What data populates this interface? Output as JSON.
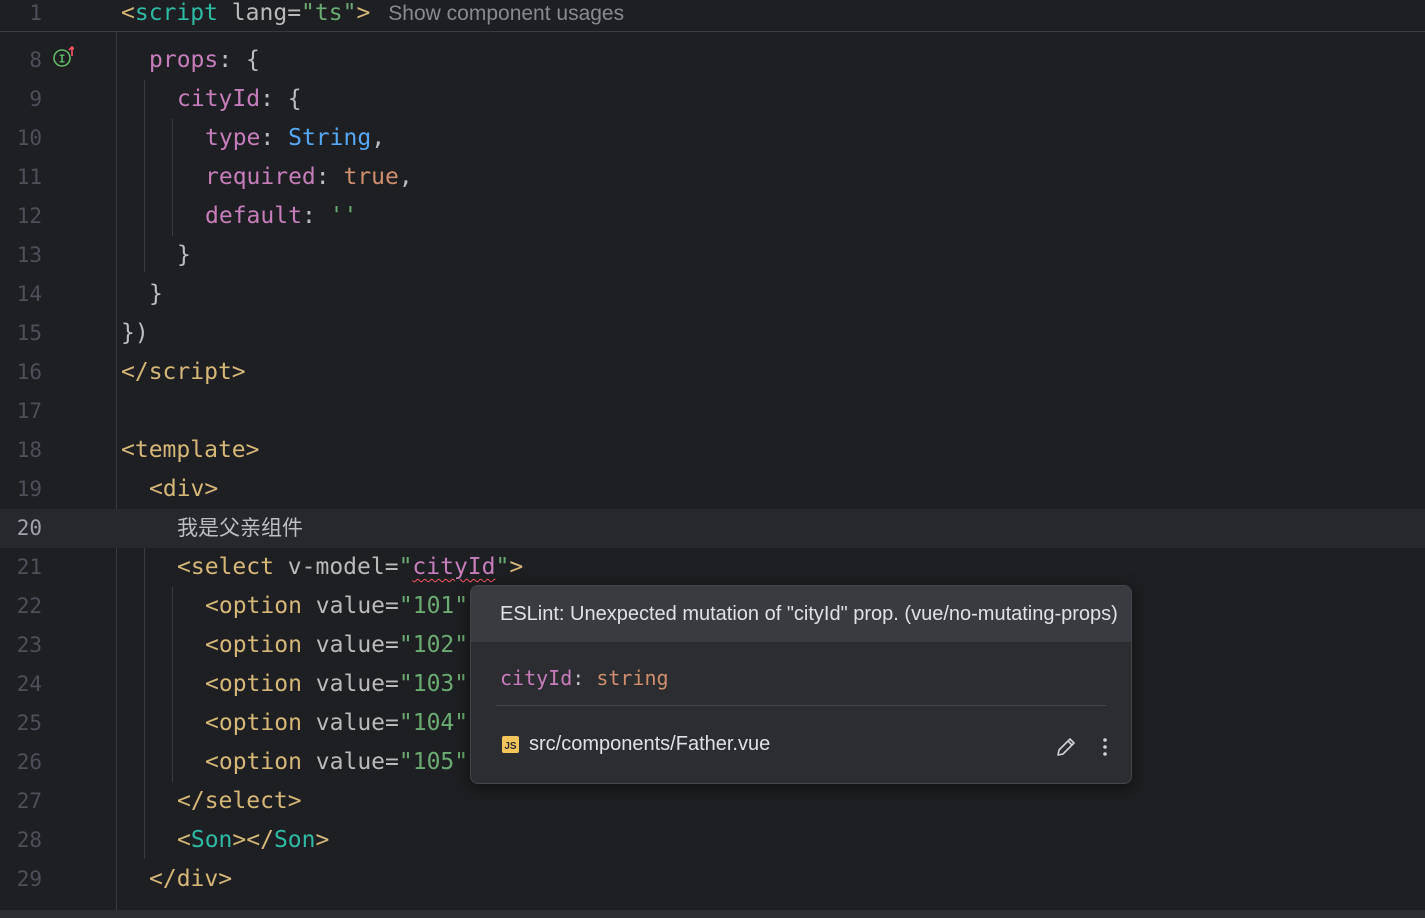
{
  "sticky_header": {
    "line_number": "1",
    "code_open": "<",
    "code_tag": "script",
    "code_attr": " lang=",
    "code_value": "\"ts\"",
    "code_close": ">",
    "inlay_hint": "Show component usages"
  },
  "gutter_icon": "implementation-up-icon",
  "current_line": "20",
  "lines": [
    {
      "n": "8"
    },
    {
      "n": "9"
    },
    {
      "n": "10"
    },
    {
      "n": "11"
    },
    {
      "n": "12"
    },
    {
      "n": "13"
    },
    {
      "n": "14"
    },
    {
      "n": "15"
    },
    {
      "n": "16"
    },
    {
      "n": "17"
    },
    {
      "n": "18"
    },
    {
      "n": "19"
    },
    {
      "n": "20"
    },
    {
      "n": "21"
    },
    {
      "n": "22"
    },
    {
      "n": "23"
    },
    {
      "n": "24"
    },
    {
      "n": "25"
    },
    {
      "n": "26"
    },
    {
      "n": "27"
    },
    {
      "n": "28"
    },
    {
      "n": "29"
    }
  ],
  "code": {
    "l8_prop": "props",
    "l8_rest": ": {",
    "l9_prop": "cityId",
    "l9_rest": ": {",
    "l10_prop": "type",
    "l10_colon": ": ",
    "l10_type": "String",
    "l10_comma": ",",
    "l11_prop": "required",
    "l11_colon": ": ",
    "l11_kw": "true",
    "l11_comma": ",",
    "l12_prop": "default",
    "l12_colon": ": ",
    "l12_str": "''",
    "l13": "}",
    "l14": "}",
    "l15": "})",
    "l16_open": "</",
    "l16_tag": "script",
    "l16_close": ">",
    "l18_open": "<",
    "l18_tag": "template",
    "l18_close": ">",
    "l19": "<div>",
    "l20_text": "我是父亲组件",
    "l21_open": "<select",
    "l21_attr": " v-model=",
    "l21_q1": "\"",
    "l21_val": "cityId",
    "l21_q2": "\"",
    "l21_close": ">",
    "l22_open": "<option",
    "l22_attr": " value=",
    "l22_val": "\"101\"",
    "l23_open": "<option",
    "l23_attr": " value=",
    "l23_val": "\"102\"",
    "l24_open": "<option",
    "l24_attr": " value=",
    "l24_val": "\"103\"",
    "l25_open": "<option",
    "l25_attr": " value=",
    "l25_val": "\"104\"",
    "l26_open": "<option",
    "l26_attr": " value=",
    "l26_val": "\"105\"",
    "l27": "</select>",
    "l28_open": "<",
    "l28_tag1": "Son",
    "l28_mid": "></",
    "l28_tag2": "Son",
    "l28_close": ">",
    "l29": "</div>"
  },
  "popup": {
    "message": "ESLint: Unexpected mutation of \"cityId\" prop. (vue/no-mutating-props)",
    "sig_name": "cityId",
    "sig_colon": ": ",
    "sig_type": "string",
    "badge": "JS",
    "file_path": "src/components/Father.vue",
    "edit_icon": "pencil-icon",
    "more_icon": "more-vertical-icon"
  },
  "colors": {
    "background": "#1e1f22",
    "tag": "#d5b778",
    "component_tag": "#2fbaa3",
    "string": "#6aab73",
    "property": "#c77dbb",
    "type": "#56a8f5",
    "keyword": "#cf8e6d",
    "error_squiggle": "#f75464"
  }
}
